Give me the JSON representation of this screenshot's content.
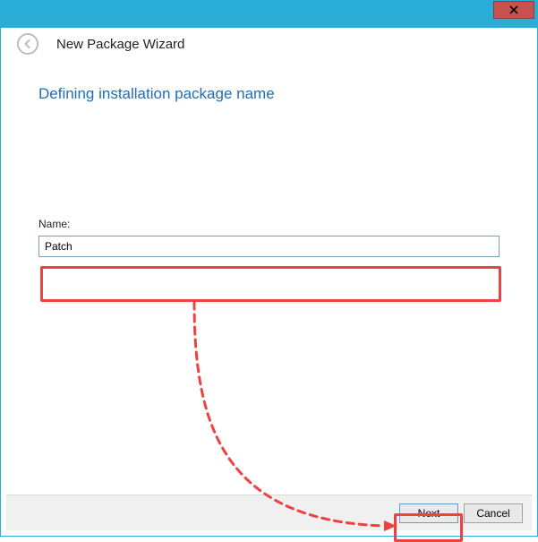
{
  "window": {
    "title": "New Package Wizard",
    "close_icon": "close-icon"
  },
  "step": {
    "heading": "Defining installation package name",
    "name_label": "Name:",
    "name_value": "Patch"
  },
  "buttons": {
    "next": "Next",
    "cancel": "Cancel"
  },
  "colors": {
    "accent": "#2aaed8",
    "link": "#1f6db8",
    "annotation": "#ef4141",
    "close": "#c75050"
  }
}
